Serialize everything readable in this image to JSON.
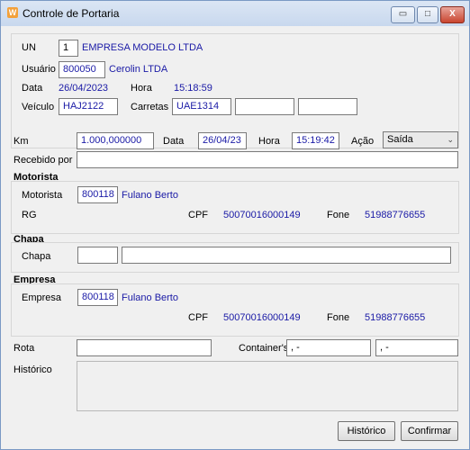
{
  "window": {
    "title": "Controle de Portaria",
    "icon": "app-icon",
    "minimize": "▭",
    "maximize": "□",
    "close": "X"
  },
  "top": {
    "un_label": "UN",
    "un_value": "1",
    "un_name": "EMPRESA MODELO LTDA",
    "usuario_label": "Usuário",
    "usuario_value": "800050",
    "usuario_name": "Cerolin LTDA",
    "data_label": "Data",
    "data_value": "26/04/2023",
    "hora_label": "Hora",
    "hora_value": "15:18:59",
    "veiculo_label": "Veículo",
    "veiculo_value": "HAJ2122",
    "carretas_label": "Carretas",
    "carreta1_value": "UAE1314",
    "carreta2_value": "",
    "carreta3_value": ""
  },
  "row": {
    "km_label": "Km",
    "km_value": "1.000,000000",
    "data_label": "Data",
    "data_value": "26/04/23",
    "hora_label": "Hora",
    "hora_value": "15:19:42",
    "acao_label": "Ação",
    "acao_value": "Saída",
    "recebido_label": "Recebido por",
    "recebido_value": ""
  },
  "motorista": {
    "section_title": "Motorista",
    "motorista_label": "Motorista",
    "motorista_code": "800118",
    "motorista_name": "Fulano Berto",
    "rg_label": "RG",
    "cpf_label": "CPF",
    "cpf_value": "50070016000149",
    "fone_label": "Fone",
    "fone_value": "51988776655"
  },
  "chapa": {
    "section_title": "Chapa",
    "chapa_label": "Chapa",
    "chapa_code": "",
    "chapa_name": ""
  },
  "empresa": {
    "section_title": "Empresa",
    "empresa_label": "Empresa",
    "empresa_code": "800118",
    "empresa_name": "Fulano Berto",
    "cpf_label": "CPF",
    "cpf_value": "50070016000149",
    "fone_label": "Fone",
    "fone_value": "51988776655"
  },
  "bottom": {
    "rota_label": "Rota",
    "rota_value": "",
    "container_label": "Container's",
    "container1_value": ",    -",
    "container2_value": ",    -",
    "historico_label": "Histórico",
    "historico_value": ""
  },
  "buttons": {
    "historico": "Histórico",
    "confirmar": "Confirmar"
  }
}
